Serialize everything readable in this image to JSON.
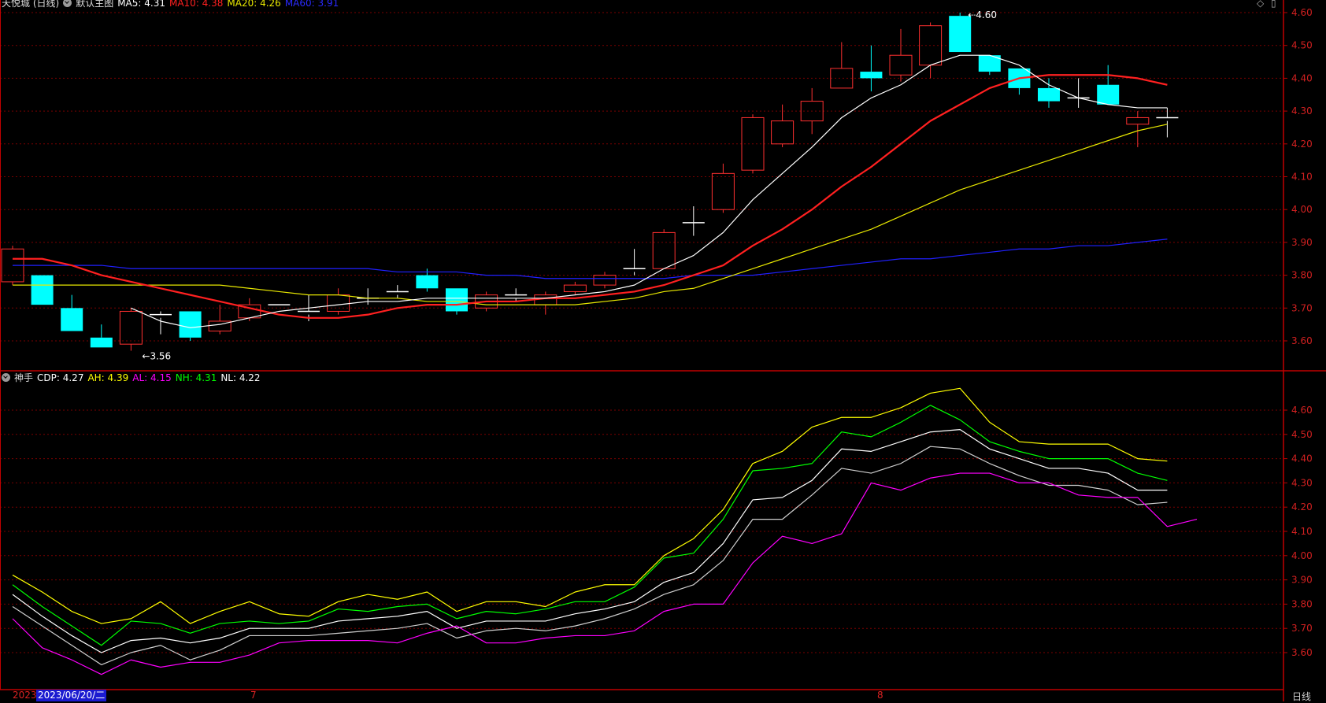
{
  "main": {
    "stock_label": "天悦城 (日线)",
    "template_label": "默认主图",
    "ma5": {
      "label": "MA5: 4.31",
      "color": "#ffffff"
    },
    "ma10": {
      "label": "MA10: 4.38",
      "color": "#ff2020"
    },
    "ma20": {
      "label": "MA20: 4.26",
      "color": "#e8e800"
    },
    "ma60": {
      "label": "MA60: 3.91",
      "color": "#2020ff"
    },
    "high_marker": "4.60",
    "low_marker": "3.56",
    "y_ticks": [
      "4.60",
      "4.50",
      "4.40",
      "4.30",
      "4.20",
      "4.10",
      "4.00",
      "3.90",
      "3.80",
      "3.70",
      "3.60"
    ]
  },
  "sub": {
    "indicator_label": "神手",
    "cdp": {
      "label": "CDP: 4.27",
      "color": "#ffffff"
    },
    "ah": {
      "label": "AH: 4.39",
      "color": "#ffff00"
    },
    "al": {
      "label": "AL: 4.15",
      "color": "#ff00ff"
    },
    "nh": {
      "label": "NH: 4.31",
      "color": "#00ff00"
    },
    "nl": {
      "label": "NL: 4.22",
      "color": "#ffffff"
    },
    "y_ticks": [
      "4.60",
      "4.50",
      "4.40",
      "4.30",
      "4.20",
      "4.10",
      "4.00",
      "3.90",
      "3.80",
      "3.70",
      "3.60"
    ]
  },
  "axis": {
    "year_label": "2023",
    "cursor_date": "2023/06/20/二",
    "month_july": "7",
    "month_aug": "8",
    "period_button": "日线"
  },
  "colors": {
    "up": "#ff3030",
    "down": "#00ffff",
    "grid": "#7a0000",
    "axis": "#c00000"
  },
  "chart_data": {
    "type": "candlestick",
    "ohlc": [
      [
        3.78,
        3.89,
        3.77,
        3.88
      ],
      [
        3.8,
        3.8,
        3.71,
        3.71
      ],
      [
        3.7,
        3.74,
        3.63,
        3.63
      ],
      [
        3.61,
        3.65,
        3.58,
        3.58
      ],
      [
        3.59,
        3.7,
        3.57,
        3.69
      ],
      [
        3.67,
        3.69,
        3.62,
        3.68
      ],
      [
        3.69,
        3.69,
        3.6,
        3.61
      ],
      [
        3.63,
        3.71,
        3.62,
        3.66
      ],
      [
        3.67,
        3.73,
        3.66,
        3.71
      ],
      [
        3.71,
        3.71,
        3.7,
        3.7
      ],
      [
        3.68,
        3.74,
        3.66,
        3.69
      ],
      [
        3.69,
        3.76,
        3.68,
        3.74
      ],
      [
        3.73,
        3.76,
        3.71,
        3.73
      ],
      [
        3.74,
        3.77,
        3.73,
        3.75
      ],
      [
        3.8,
        3.82,
        3.75,
        3.76
      ],
      [
        3.76,
        3.76,
        3.68,
        3.69
      ],
      [
        3.7,
        3.75,
        3.69,
        3.74
      ],
      [
        3.74,
        3.76,
        3.72,
        3.73
      ],
      [
        3.71,
        3.75,
        3.68,
        3.74
      ],
      [
        3.75,
        3.78,
        3.74,
        3.77
      ],
      [
        3.77,
        3.81,
        3.76,
        3.8
      ],
      [
        3.81,
        3.88,
        3.8,
        3.82
      ],
      [
        3.82,
        3.94,
        3.82,
        3.93
      ],
      [
        3.96,
        4.01,
        3.92,
        3.96
      ],
      [
        4.0,
        4.14,
        3.99,
        4.11
      ],
      [
        4.12,
        4.29,
        4.11,
        4.28
      ],
      [
        4.2,
        4.32,
        4.19,
        4.27
      ],
      [
        4.27,
        4.37,
        4.23,
        4.33
      ],
      [
        4.37,
        4.51,
        4.37,
        4.43
      ],
      [
        4.42,
        4.5,
        4.36,
        4.4
      ],
      [
        4.41,
        4.55,
        4.39,
        4.47
      ],
      [
        4.44,
        4.57,
        4.4,
        4.56
      ],
      [
        4.59,
        4.6,
        4.48,
        4.48
      ],
      [
        4.47,
        4.47,
        4.41,
        4.42
      ],
      [
        4.43,
        4.43,
        4.35,
        4.37
      ],
      [
        4.37,
        4.4,
        4.31,
        4.33
      ],
      [
        4.34,
        4.4,
        4.31,
        4.34
      ],
      [
        4.38,
        4.44,
        4.32,
        4.32
      ],
      [
        4.26,
        4.3,
        4.19,
        4.28
      ],
      [
        4.28,
        4.31,
        4.22,
        4.27
      ]
    ],
    "ma5": [
      null,
      null,
      null,
      null,
      3.7,
      3.66,
      3.64,
      3.65,
      3.67,
      3.69,
      3.7,
      3.71,
      3.72,
      3.72,
      3.73,
      3.73,
      3.73,
      3.73,
      3.73,
      3.74,
      3.75,
      3.77,
      3.82,
      3.86,
      3.93,
      4.03,
      4.11,
      4.19,
      4.28,
      4.34,
      4.38,
      4.44,
      4.47,
      4.47,
      4.44,
      4.38,
      4.34,
      4.32,
      4.31,
      4.31
    ],
    "ma10": [
      3.85,
      3.85,
      3.83,
      3.8,
      3.78,
      3.76,
      3.74,
      3.72,
      3.7,
      3.68,
      3.67,
      3.67,
      3.68,
      3.7,
      3.71,
      3.71,
      3.72,
      3.72,
      3.73,
      3.73,
      3.74,
      3.75,
      3.77,
      3.8,
      3.83,
      3.89,
      3.94,
      4.0,
      4.07,
      4.13,
      4.2,
      4.27,
      4.32,
      4.37,
      4.4,
      4.41,
      4.41,
      4.41,
      4.4,
      4.38
    ],
    "ma20": [
      3.77,
      3.77,
      3.77,
      3.77,
      3.77,
      3.77,
      3.77,
      3.77,
      3.76,
      3.75,
      3.74,
      3.74,
      3.73,
      3.73,
      3.72,
      3.72,
      3.71,
      3.71,
      3.71,
      3.71,
      3.72,
      3.73,
      3.75,
      3.76,
      3.79,
      3.82,
      3.85,
      3.88,
      3.91,
      3.94,
      3.98,
      4.02,
      4.06,
      4.09,
      4.12,
      4.15,
      4.18,
      4.21,
      4.24,
      4.26
    ],
    "ma60": [
      3.83,
      3.83,
      3.83,
      3.83,
      3.82,
      3.82,
      3.82,
      3.82,
      3.82,
      3.82,
      3.82,
      3.82,
      3.82,
      3.81,
      3.81,
      3.81,
      3.8,
      3.8,
      3.79,
      3.79,
      3.79,
      3.79,
      3.79,
      3.8,
      3.8,
      3.8,
      3.81,
      3.82,
      3.83,
      3.84,
      3.85,
      3.85,
      3.86,
      3.87,
      3.88,
      3.88,
      3.89,
      3.89,
      3.9,
      3.91
    ],
    "ah": [
      3.92,
      3.85,
      3.77,
      3.72,
      3.74,
      3.81,
      3.72,
      3.77,
      3.81,
      3.76,
      3.75,
      3.81,
      3.84,
      3.82,
      3.85,
      3.77,
      3.81,
      3.81,
      3.79,
      3.85,
      3.88,
      3.88,
      4.0,
      4.07,
      4.19,
      4.38,
      4.43,
      4.53,
      4.57,
      4.57,
      4.61,
      4.67,
      4.69,
      4.55,
      4.47,
      4.46,
      4.46,
      4.46,
      4.4,
      4.39
    ],
    "nh": [
      3.88,
      3.79,
      3.71,
      3.63,
      3.73,
      3.72,
      3.68,
      3.72,
      3.73,
      3.72,
      3.73,
      3.78,
      3.77,
      3.79,
      3.8,
      3.74,
      3.77,
      3.76,
      3.78,
      3.81,
      3.81,
      3.87,
      3.99,
      4.01,
      4.15,
      4.35,
      4.36,
      4.38,
      4.51,
      4.49,
      4.55,
      4.62,
      4.56,
      4.47,
      4.43,
      4.4,
      4.4,
      4.4,
      4.34,
      4.31
    ],
    "cdp": [
      3.84,
      3.75,
      3.67,
      3.6,
      3.65,
      3.66,
      3.64,
      3.66,
      3.7,
      3.7,
      3.7,
      3.73,
      3.74,
      3.75,
      3.77,
      3.7,
      3.73,
      3.73,
      3.73,
      3.76,
      3.78,
      3.81,
      3.89,
      3.93,
      4.05,
      4.23,
      4.24,
      4.31,
      4.44,
      4.43,
      4.47,
      4.51,
      4.52,
      4.44,
      4.4,
      4.36,
      4.36,
      4.34,
      4.27,
      4.27
    ],
    "nl": [
      3.79,
      3.71,
      3.63,
      3.55,
      3.6,
      3.63,
      3.57,
      3.61,
      3.67,
      3.67,
      3.67,
      3.68,
      3.69,
      3.7,
      3.72,
      3.66,
      3.69,
      3.7,
      3.69,
      3.71,
      3.74,
      3.78,
      3.84,
      3.88,
      3.98,
      4.15,
      4.15,
      4.25,
      4.36,
      4.34,
      4.38,
      4.45,
      4.44,
      4.38,
      4.33,
      4.29,
      4.29,
      4.27,
      4.21,
      4.22
    ],
    "al": [
      3.74,
      3.62,
      3.57,
      3.51,
      3.57,
      3.54,
      3.56,
      3.56,
      3.59,
      3.64,
      3.65,
      3.65,
      3.65,
      3.64,
      3.68,
      3.71,
      3.64,
      3.64,
      3.66,
      3.67,
      3.67,
      3.69,
      3.77,
      3.8,
      3.8,
      3.97,
      4.08,
      4.05,
      4.09,
      4.3,
      4.27,
      4.32,
      4.34,
      4.34,
      4.3,
      4.3,
      4.25,
      4.24,
      4.24,
      4.12,
      4.15
    ]
  }
}
